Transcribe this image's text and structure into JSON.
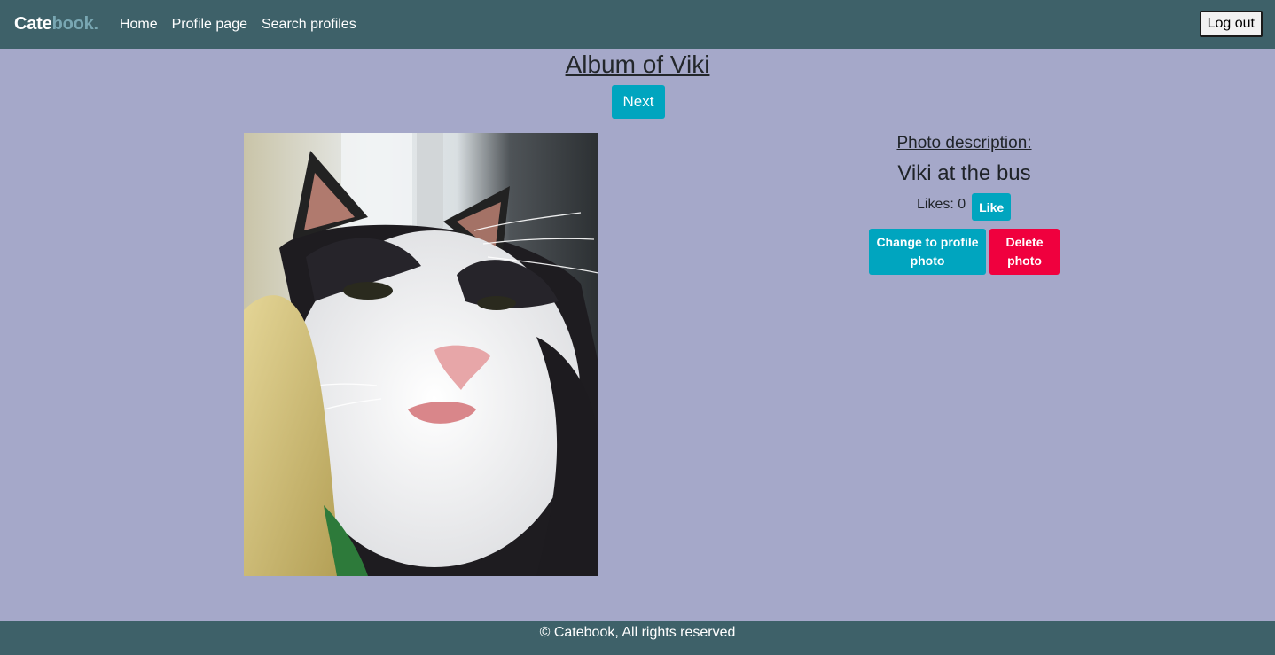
{
  "navbar": {
    "brand_part1": "Cate",
    "brand_part2": "book.",
    "links": [
      "Home",
      "Profile page",
      "Search profiles"
    ],
    "logout_label": "Log out"
  },
  "album": {
    "title": "Album of Viki",
    "next_label": "Next"
  },
  "photo": {
    "alt": "Viki at the bus"
  },
  "description": {
    "heading": "Photo description:",
    "text": "Viki at the bus",
    "likes_label": "Likes: 0",
    "like_button": "Like",
    "change_profile_button": "Change to profile photo",
    "delete_button": "Delete photo"
  },
  "footer": {
    "text": "© Catebook, All rights reserved"
  },
  "colors": {
    "background": "#a5a8c9",
    "navbar": "#3e6169",
    "accent": "#00a5bf",
    "danger": "#f0003e"
  }
}
